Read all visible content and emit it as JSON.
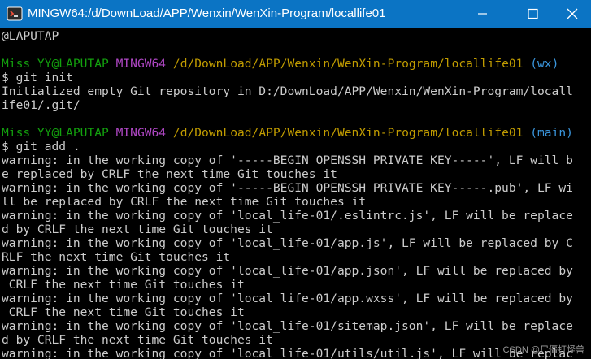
{
  "window": {
    "title": "MINGW64:/d/DownLoad/APP/Wenxin/WenXin-Program/locallife01",
    "icon": "git-bash-icon",
    "controls": [
      "minimize-icon",
      "maximize-icon",
      "close-icon"
    ],
    "titlebar_color": "#0b74c4"
  },
  "terminal": {
    "colors": {
      "background": "#000000",
      "text": "#cccccc",
      "user": "#13a10e",
      "shell": "#b148c6",
      "path": "#c19c00",
      "branch": "#3a96dd"
    },
    "line0": "@LAPUTAP",
    "prompt1": {
      "user": "Miss YY@LAPUTAP",
      "shell": "MINGW64",
      "path": "/d/DownLoad/APP/Wenxin/WenXin-Program/locallife01",
      "branch": "(wx)"
    },
    "cmd1": "$ git init",
    "out1": [
      "Initialized empty Git repository in D:/DownLoad/APP/Wenxin/WenXin-Program/locall",
      "ife01/.git/"
    ],
    "prompt2": {
      "user": "Miss YY@LAPUTAP",
      "shell": "MINGW64",
      "path": "/d/DownLoad/APP/Wenxin/WenXin-Program/locallife01",
      "branch": "(main)"
    },
    "cmd2": "$ git add .",
    "out2": [
      "warning: in the working copy of '-----BEGIN OPENSSH PRIVATE KEY-----', LF will b",
      "e replaced by CRLF the next time Git touches it",
      "warning: in the working copy of '-----BEGIN OPENSSH PRIVATE KEY-----.pub', LF wi",
      "ll be replaced by CRLF the next time Git touches it",
      "warning: in the working copy of 'local_life-01/.eslintrc.js', LF will be replace",
      "d by CRLF the next time Git touches it",
      "warning: in the working copy of 'local_life-01/app.js', LF will be replaced by C",
      "RLF the next time Git touches it",
      "warning: in the working copy of 'local_life-01/app.json', LF will be replaced by",
      " CRLF the next time Git touches it",
      "warning: in the working copy of 'local_life-01/app.wxss', LF will be replaced by",
      " CRLF the next time Git touches it",
      "warning: in the working copy of 'local_life-01/sitemap.json', LF will be replace",
      "d by CRLF the next time Git touches it",
      "warning: in the working copy of 'local_life-01/utils/util.js', LF will be replac"
    ]
  },
  "watermark": "CSDN @尸僵打怪兽"
}
